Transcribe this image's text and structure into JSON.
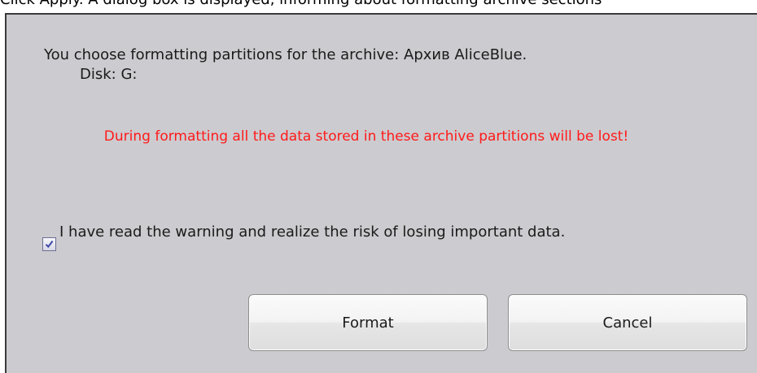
{
  "background_caption": "Click Apply. A dialog box is displayed, informing about formatting archive sections",
  "dialog": {
    "info_line1": "You choose formatting partitions for the archive: Архив AliceBlue.",
    "info_line2": "Disk: G:",
    "warning": "During formatting all the data stored in these archive partitions will be lost!",
    "warning_color": "#ff1a1a",
    "confirm_checked": true,
    "confirm_label": "I have read the warning and realize the risk of losing important data.",
    "format_button": "Format",
    "cancel_button": "Cancel",
    "background_color": "#cccbcf"
  }
}
